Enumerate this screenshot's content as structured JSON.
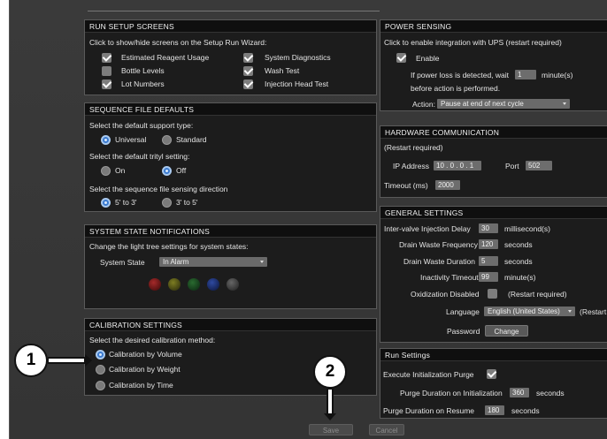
{
  "run_setup": {
    "title": "RUN SETUP SCREENS",
    "hint": "Click to show/hide screens on the Setup Run Wizard:",
    "items": [
      {
        "label": "Estimated Reagent Usage",
        "checked": true
      },
      {
        "label": "Bottle Levels",
        "checked": false
      },
      {
        "label": "Lot Numbers",
        "checked": true
      },
      {
        "label": "System Diagnostics",
        "checked": true
      },
      {
        "label": "Wash Test",
        "checked": true
      },
      {
        "label": "Injection Head Test",
        "checked": true
      }
    ]
  },
  "sequence": {
    "title": "SEQUENCE FILE DEFAULTS",
    "support_q": "Select the default support type:",
    "support_opts": [
      "Universal",
      "Standard"
    ],
    "trityl_q": "Select the default trityl setting:",
    "trityl_opts": [
      "On",
      "Off"
    ],
    "direction_q": "Select the sequence file sensing direction",
    "direction_opts": [
      "5' to 3'",
      "3' to 5'"
    ]
  },
  "system_state": {
    "title": "SYSTEM STATE NOTIFICATIONS",
    "hint": "Change the light tree settings for system states:",
    "state_label": "System State",
    "state_value": "In Alarm",
    "led_colors": [
      "#6b1111",
      "#4d4d12",
      "#12421a",
      "#142a66",
      "#3c3c3c"
    ]
  },
  "calibration": {
    "title": "CALIBRATION SETTINGS",
    "hint": "Select the desired calibration method:",
    "options": [
      "Calibration by Volume",
      "Calibration by Weight",
      "Calibration by Time"
    ]
  },
  "power": {
    "title": "POWER SENSING",
    "hint": "Click to enable integration with UPS  (restart required)",
    "enable_label": "Enable",
    "wait_pre": "If power loss is detected, wait",
    "wait_value": "1",
    "wait_post": "minute(s)",
    "wait_line2": "before action is performed.",
    "action_label": "Action:",
    "action_value": "Pause at end of next cycle"
  },
  "hardware": {
    "title": "HARDWARE COMMUNICATION",
    "note": "(Restart required)",
    "ip_label": "IP Address",
    "ip_value": "10 . 0 . 0 . 1",
    "port_label": "Port",
    "port_value": "502",
    "timeout_label": "Timeout (ms)",
    "timeout_value": "2000"
  },
  "general": {
    "title": "GENERAL SETTINGS",
    "rows": [
      {
        "label": "Inter-valve Injection Delay",
        "value": "30",
        "unit": "millisecond(s)"
      },
      {
        "label": "Drain Waste Frequency",
        "value": "120",
        "unit": "seconds"
      },
      {
        "label": "Drain Waste Duration",
        "value": "5",
        "unit": "seconds"
      },
      {
        "label": "Inactivity Timeout",
        "value": "99",
        "unit": "minute(s)"
      }
    ],
    "oxid_label": "Oxidization Disabled",
    "oxid_note": "(Restart required)",
    "language_label": "Language",
    "language_value": "English (United States)",
    "language_note": "(Restart re",
    "password_label": "Password",
    "change_label": "Change"
  },
  "run_settings": {
    "title": "Run Settings",
    "purge_label": "Execute Initialization Purge",
    "init_label": "Purge Duration on Initialization",
    "init_value": "360",
    "init_unit": "seconds",
    "resume_label": "Purge Duration on Resume",
    "resume_value": "180",
    "resume_unit": "seconds"
  },
  "footer": {
    "save": "Save",
    "cancel": "Cancel"
  },
  "callouts": {
    "one": "1",
    "two": "2"
  }
}
